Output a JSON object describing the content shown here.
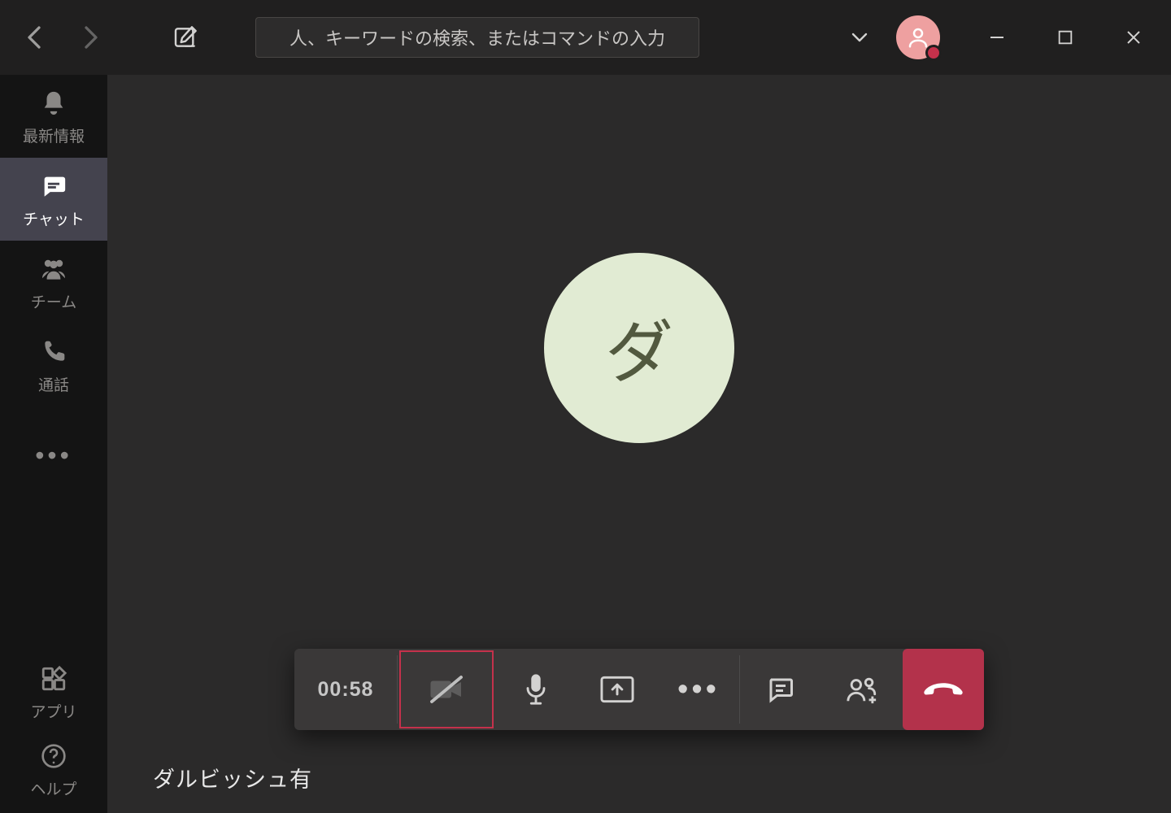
{
  "search_placeholder": "人、キーワードの検索、またはコマンドの入力",
  "rail": {
    "activity": "最新情報",
    "chat": "チャット",
    "teams": "チーム",
    "calls": "通話",
    "apps": "アプリ",
    "help": "ヘルプ"
  },
  "call": {
    "participant_initial": "ダ",
    "timer": "00:58",
    "participant_name": "ダルビッシュ有"
  },
  "colors": {
    "hangup": "#b3324b",
    "highlight_border": "#c4314b",
    "avatar_bg": "#e1ebd3",
    "avatar_fg": "#52593f",
    "user_avatar": "#eea0a0"
  }
}
